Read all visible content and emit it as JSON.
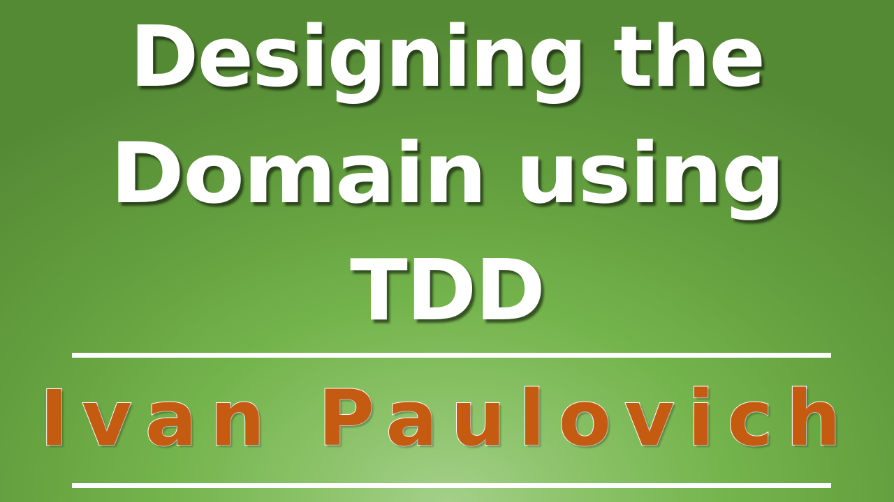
{
  "title": {
    "line1": "Designing the",
    "line2": "Domain using",
    "line3": "TDD"
  },
  "author": "Ivan Paulovich",
  "colors": {
    "background": "#74b44c",
    "title_text": "#ffffff",
    "author_text": "#c55a11",
    "rules": "#ffffff"
  }
}
